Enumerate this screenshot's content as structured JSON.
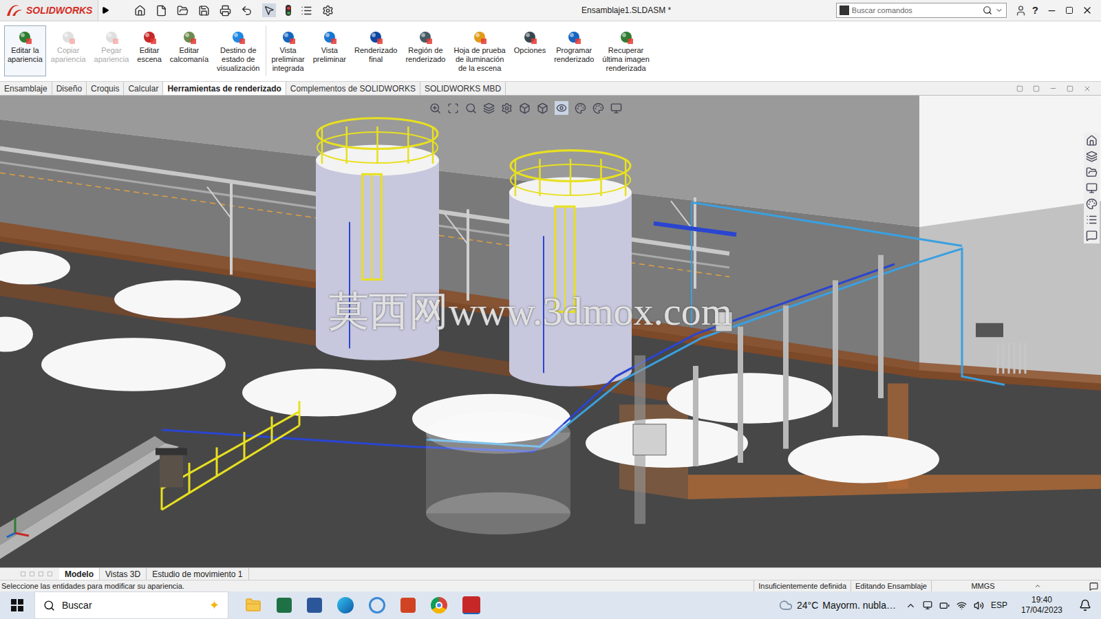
{
  "window": {
    "app": "SOLIDWORKS",
    "title": "Ensamblaje1.SLDASM *",
    "help": "?"
  },
  "search": {
    "placeholder": "Buscar comandos"
  },
  "ribbon": {
    "groups": [
      [
        {
          "label": "Editar la\napariencia",
          "disabled": false,
          "selected": true
        },
        {
          "label": "Copiar\napariencia",
          "disabled": true,
          "selected": false
        },
        {
          "label": "Pegar\napariencia",
          "disabled": true,
          "selected": false
        },
        {
          "label": "Editar\nescena",
          "disabled": false,
          "selected": false
        },
        {
          "label": "Editar\ncalcomanía",
          "disabled": false,
          "selected": false
        },
        {
          "label": "Destino de\nestado de\nvisualización",
          "disabled": false,
          "selected": false
        }
      ],
      [
        {
          "label": "Vista\npreliminar\nintegrada",
          "disabled": false,
          "selected": false
        },
        {
          "label": "Vista\npreliminar",
          "disabled": false,
          "selected": false
        },
        {
          "label": "Renderizado\nfinal",
          "disabled": false,
          "selected": false
        },
        {
          "label": "Región de\nrenderizado",
          "disabled": false,
          "selected": false
        },
        {
          "label": "Hoja de prueba\nde iluminación\nde la escena",
          "disabled": false,
          "selected": false
        },
        {
          "label": "Opciones",
          "disabled": false,
          "selected": false
        },
        {
          "label": "Programar\nrenderizado",
          "disabled": false,
          "selected": false
        },
        {
          "label": "Recuperar\núltima imagen\nrenderizada",
          "disabled": false,
          "selected": false
        }
      ]
    ]
  },
  "tabs": [
    {
      "label": "Ensamblaje",
      "selected": false
    },
    {
      "label": "Diseño",
      "selected": false
    },
    {
      "label": "Croquis",
      "selected": false
    },
    {
      "label": "Calcular",
      "selected": false
    },
    {
      "label": "Herramientas de renderizado",
      "selected": true
    },
    {
      "label": "Complementos de SOLIDWORKS",
      "selected": false
    },
    {
      "label": "SOLIDWORKS MBD",
      "selected": false
    }
  ],
  "viewport": {
    "watermark": "莫西网www.3dmox.com"
  },
  "bottom_tabs": [
    {
      "label": "Modelo",
      "selected": true
    },
    {
      "label": "Vistas 3D",
      "selected": false
    },
    {
      "label": "Estudio de movimiento 1",
      "selected": false
    }
  ],
  "status_bar": {
    "message": "Seleccione las entidades para modificar su apariencia.",
    "sections": [
      "Insuficientemente definida",
      "Editando Ensamblaje",
      "MMGS"
    ]
  },
  "taskbar": {
    "search": "Buscar",
    "weather": {
      "temp": "24°C",
      "text": "Mayorm. nubla…"
    },
    "language": "ESP",
    "time": "19:40",
    "date": "17/04/2023"
  }
}
